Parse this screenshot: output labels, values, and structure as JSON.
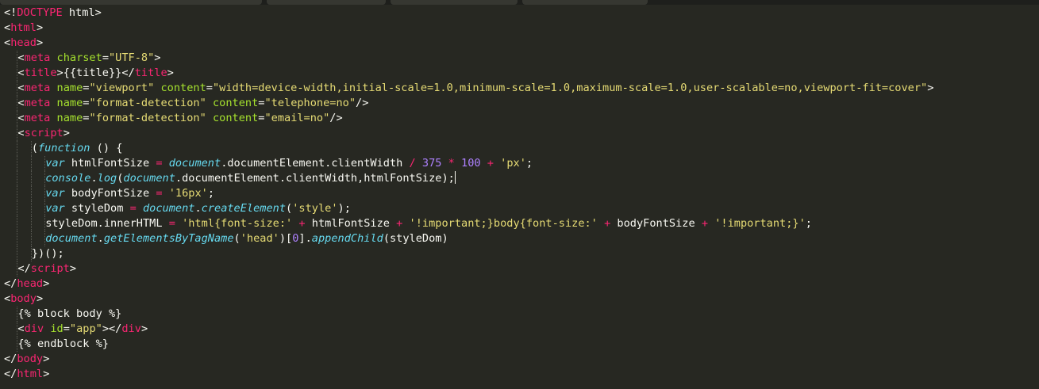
{
  "colors": {
    "background": "#272822",
    "plain": "#f8f8f2",
    "keyword": "#f92672",
    "attribute": "#a6e22e",
    "string": "#e6db74",
    "storage": "#66d9ef",
    "number": "#ae81ff"
  },
  "editor": {
    "lines": [
      {
        "indent": 0,
        "tokens": [
          {
            "t": "<!",
            "c": "plain"
          },
          {
            "t": "DOCTYPE",
            "c": "keyword"
          },
          {
            "t": " html>",
            "c": "plain"
          }
        ]
      },
      {
        "indent": 0,
        "tokens": [
          {
            "t": "<",
            "c": "plain"
          },
          {
            "t": "html",
            "c": "keyword"
          },
          {
            "t": ">",
            "c": "plain"
          }
        ]
      },
      {
        "indent": 0,
        "tokens": [
          {
            "t": "<",
            "c": "plain"
          },
          {
            "t": "head",
            "c": "keyword"
          },
          {
            "t": ">",
            "c": "plain"
          }
        ]
      },
      {
        "indent": 1,
        "tokens": [
          {
            "t": "<",
            "c": "plain"
          },
          {
            "t": "meta",
            "c": "keyword"
          },
          {
            "t": " ",
            "c": "plain"
          },
          {
            "t": "charset",
            "c": "attribute"
          },
          {
            "t": "=",
            "c": "plain"
          },
          {
            "t": "\"UTF-8\"",
            "c": "string"
          },
          {
            "t": ">",
            "c": "plain"
          }
        ]
      },
      {
        "indent": 1,
        "tokens": [
          {
            "t": "<",
            "c": "plain"
          },
          {
            "t": "title",
            "c": "keyword"
          },
          {
            "t": ">{{title}}</",
            "c": "plain"
          },
          {
            "t": "title",
            "c": "keyword"
          },
          {
            "t": ">",
            "c": "plain"
          }
        ]
      },
      {
        "indent": 1,
        "tokens": [
          {
            "t": "<",
            "c": "plain"
          },
          {
            "t": "meta",
            "c": "keyword"
          },
          {
            "t": " ",
            "c": "plain"
          },
          {
            "t": "name",
            "c": "attribute"
          },
          {
            "t": "=",
            "c": "plain"
          },
          {
            "t": "\"viewport\"",
            "c": "string"
          },
          {
            "t": " ",
            "c": "plain"
          },
          {
            "t": "content",
            "c": "attribute"
          },
          {
            "t": "=",
            "c": "plain"
          },
          {
            "t": "\"width=device-width,initial-scale=1.0,minimum-scale=1.0,maximum-scale=1.0,user-scalable=no,viewport-fit=cover\"",
            "c": "string"
          },
          {
            "t": ">",
            "c": "plain"
          }
        ]
      },
      {
        "indent": 1,
        "tokens": [
          {
            "t": "<",
            "c": "plain"
          },
          {
            "t": "meta",
            "c": "keyword"
          },
          {
            "t": " ",
            "c": "plain"
          },
          {
            "t": "name",
            "c": "attribute"
          },
          {
            "t": "=",
            "c": "plain"
          },
          {
            "t": "\"format-detection\"",
            "c": "string"
          },
          {
            "t": " ",
            "c": "plain"
          },
          {
            "t": "content",
            "c": "attribute"
          },
          {
            "t": "=",
            "c": "plain"
          },
          {
            "t": "\"telephone=no\"",
            "c": "string"
          },
          {
            "t": "/>",
            "c": "plain"
          }
        ]
      },
      {
        "indent": 1,
        "tokens": [
          {
            "t": "<",
            "c": "plain"
          },
          {
            "t": "meta",
            "c": "keyword"
          },
          {
            "t": " ",
            "c": "plain"
          },
          {
            "t": "name",
            "c": "attribute"
          },
          {
            "t": "=",
            "c": "plain"
          },
          {
            "t": "\"format-detection\"",
            "c": "string"
          },
          {
            "t": " ",
            "c": "plain"
          },
          {
            "t": "content",
            "c": "attribute"
          },
          {
            "t": "=",
            "c": "plain"
          },
          {
            "t": "\"email=no\"",
            "c": "string"
          },
          {
            "t": "/>",
            "c": "plain"
          }
        ]
      },
      {
        "indent": 1,
        "tokens": [
          {
            "t": "<",
            "c": "plain"
          },
          {
            "t": "script",
            "c": "keyword"
          },
          {
            "t": ">",
            "c": "plain"
          }
        ]
      },
      {
        "indent": 2,
        "tokens": [
          {
            "t": "(",
            "c": "plain"
          },
          {
            "t": "function",
            "c": "storage"
          },
          {
            "t": " () {",
            "c": "plain"
          }
        ]
      },
      {
        "indent": 3,
        "tokens": [
          {
            "t": "var",
            "c": "storage"
          },
          {
            "t": " htmlFontSize ",
            "c": "plain"
          },
          {
            "t": "=",
            "c": "keyword"
          },
          {
            "t": " ",
            "c": "plain"
          },
          {
            "t": "document",
            "c": "storage"
          },
          {
            "t": ".documentElement.clientWidth ",
            "c": "plain"
          },
          {
            "t": "/",
            "c": "keyword"
          },
          {
            "t": " ",
            "c": "plain"
          },
          {
            "t": "375",
            "c": "number"
          },
          {
            "t": " ",
            "c": "plain"
          },
          {
            "t": "*",
            "c": "keyword"
          },
          {
            "t": " ",
            "c": "plain"
          },
          {
            "t": "100",
            "c": "number"
          },
          {
            "t": " ",
            "c": "plain"
          },
          {
            "t": "+",
            "c": "keyword"
          },
          {
            "t": " ",
            "c": "plain"
          },
          {
            "t": "'px'",
            "c": "string"
          },
          {
            "t": ";",
            "c": "plain"
          }
        ]
      },
      {
        "indent": 3,
        "cursor": true,
        "tokens": [
          {
            "t": "console",
            "c": "storage"
          },
          {
            "t": ".",
            "c": "plain"
          },
          {
            "t": "log",
            "c": "storage"
          },
          {
            "t": "(",
            "c": "plain"
          },
          {
            "t": "document",
            "c": "storage"
          },
          {
            "t": ".documentElement.clientWidth,htmlFontSize);",
            "c": "plain"
          }
        ]
      },
      {
        "indent": 3,
        "tokens": [
          {
            "t": "var",
            "c": "storage"
          },
          {
            "t": " bodyFontSize ",
            "c": "plain"
          },
          {
            "t": "=",
            "c": "keyword"
          },
          {
            "t": " ",
            "c": "plain"
          },
          {
            "t": "'16px'",
            "c": "string"
          },
          {
            "t": ";",
            "c": "plain"
          }
        ]
      },
      {
        "indent": 3,
        "tokens": [
          {
            "t": "var",
            "c": "storage"
          },
          {
            "t": " styleDom ",
            "c": "plain"
          },
          {
            "t": "=",
            "c": "keyword"
          },
          {
            "t": " ",
            "c": "plain"
          },
          {
            "t": "document",
            "c": "storage"
          },
          {
            "t": ".",
            "c": "plain"
          },
          {
            "t": "createElement",
            "c": "storage"
          },
          {
            "t": "(",
            "c": "plain"
          },
          {
            "t": "'style'",
            "c": "string"
          },
          {
            "t": ");",
            "c": "plain"
          }
        ]
      },
      {
        "indent": 3,
        "tokens": [
          {
            "t": "styleDom.innerHTML ",
            "c": "plain"
          },
          {
            "t": "=",
            "c": "keyword"
          },
          {
            "t": " ",
            "c": "plain"
          },
          {
            "t": "'html{font-size:'",
            "c": "string"
          },
          {
            "t": " ",
            "c": "plain"
          },
          {
            "t": "+",
            "c": "keyword"
          },
          {
            "t": " htmlFontSize ",
            "c": "plain"
          },
          {
            "t": "+",
            "c": "keyword"
          },
          {
            "t": " ",
            "c": "plain"
          },
          {
            "t": "'!important;}body{font-size:'",
            "c": "string"
          },
          {
            "t": " ",
            "c": "plain"
          },
          {
            "t": "+",
            "c": "keyword"
          },
          {
            "t": " bodyFontSize ",
            "c": "plain"
          },
          {
            "t": "+",
            "c": "keyword"
          },
          {
            "t": " ",
            "c": "plain"
          },
          {
            "t": "'!important;}'",
            "c": "string"
          },
          {
            "t": ";",
            "c": "plain"
          }
        ]
      },
      {
        "indent": 3,
        "tokens": [
          {
            "t": "document",
            "c": "storage"
          },
          {
            "t": ".",
            "c": "plain"
          },
          {
            "t": "getElementsByTagName",
            "c": "storage"
          },
          {
            "t": "(",
            "c": "plain"
          },
          {
            "t": "'head'",
            "c": "string"
          },
          {
            "t": ")[",
            "c": "plain"
          },
          {
            "t": "0",
            "c": "number"
          },
          {
            "t": "].",
            "c": "plain"
          },
          {
            "t": "appendChild",
            "c": "storage"
          },
          {
            "t": "(styleDom)",
            "c": "plain"
          }
        ]
      },
      {
        "indent": 2,
        "tokens": [
          {
            "t": "})();",
            "c": "plain"
          }
        ]
      },
      {
        "indent": 1,
        "tokens": [
          {
            "t": "</",
            "c": "plain"
          },
          {
            "t": "script",
            "c": "keyword"
          },
          {
            "t": ">",
            "c": "plain"
          }
        ]
      },
      {
        "indent": 0,
        "tokens": [
          {
            "t": "</",
            "c": "plain"
          },
          {
            "t": "head",
            "c": "keyword"
          },
          {
            "t": ">",
            "c": "plain"
          }
        ]
      },
      {
        "indent": 0,
        "tokens": [
          {
            "t": "<",
            "c": "plain"
          },
          {
            "t": "body",
            "c": "keyword"
          },
          {
            "t": ">",
            "c": "plain"
          }
        ]
      },
      {
        "indent": 1,
        "tokens": [
          {
            "t": "{% block body %}",
            "c": "plain"
          }
        ]
      },
      {
        "indent": 1,
        "tokens": [
          {
            "t": "<",
            "c": "plain"
          },
          {
            "t": "div",
            "c": "keyword"
          },
          {
            "t": " ",
            "c": "plain"
          },
          {
            "t": "id",
            "c": "attribute"
          },
          {
            "t": "=",
            "c": "plain"
          },
          {
            "t": "\"app\"",
            "c": "string"
          },
          {
            "t": "></",
            "c": "plain"
          },
          {
            "t": "div",
            "c": "keyword"
          },
          {
            "t": ">",
            "c": "plain"
          }
        ]
      },
      {
        "indent": 1,
        "tokens": [
          {
            "t": "{% endblock %}",
            "c": "plain"
          }
        ]
      },
      {
        "indent": 0,
        "tokens": [
          {
            "t": "</",
            "c": "plain"
          },
          {
            "t": "body",
            "c": "keyword"
          },
          {
            "t": ">",
            "c": "plain"
          }
        ]
      },
      {
        "indent": 0,
        "tokens": [
          {
            "t": "</",
            "c": "plain"
          },
          {
            "t": "html",
            "c": "keyword"
          },
          {
            "t": ">",
            "c": "plain"
          }
        ]
      }
    ]
  }
}
